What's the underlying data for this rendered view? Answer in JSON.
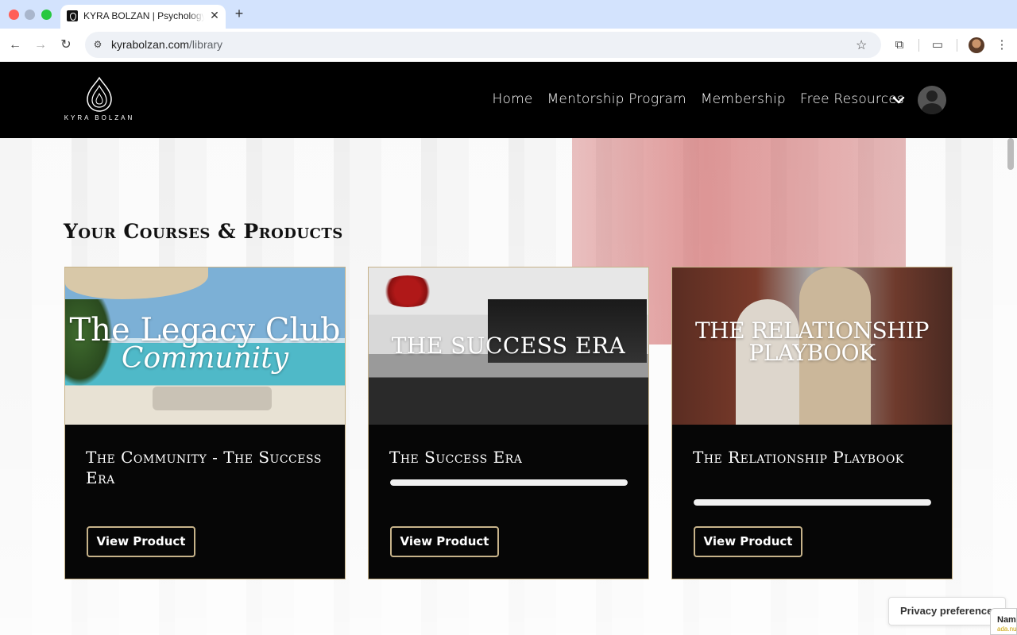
{
  "browser": {
    "tab_title": "KYRA BOLZAN | Psychology & Success",
    "tab_close": "✕",
    "new_tab": "+",
    "url_domain": "kyrabolzan.com",
    "url_path": "/library"
  },
  "header": {
    "logo_text": "KYRA BOLZAN",
    "nav": [
      {
        "label": "Home"
      },
      {
        "label": "Mentorship Program"
      },
      {
        "label": "Membership"
      },
      {
        "label": "Free Resources"
      }
    ]
  },
  "main": {
    "section_title": "Your Courses & Products",
    "cards": [
      {
        "image_title_line1": "The Legacy Club",
        "image_title_line2": "Community",
        "title": "The Community - The Success Era",
        "button": "View Product"
      },
      {
        "image_title": "THE SUCCESS ERA",
        "title": "The Success Era",
        "progress": 1.0,
        "button": "View Product"
      },
      {
        "image_title": "THE RELATIONSHIP PLAYBOOK",
        "title": "The Relationship Playbook",
        "progress": 1.0,
        "button": "View Product"
      }
    ]
  },
  "privacy": {
    "label": "Privacy preferences"
  },
  "widget": {
    "name": "Name",
    "sub": "ada.nu"
  },
  "colors": {
    "header_bg": "#000000",
    "card_bg": "#060606",
    "accent_gold": "#c7b38a"
  },
  "icons": {
    "back": "back-arrow-icon",
    "forward": "forward-arrow-icon",
    "reload": "reload-icon",
    "site_info": "tune-icon",
    "bookmark": "star-icon",
    "extensions": "puzzle-icon",
    "reading_mode": "reading-mode-icon",
    "menu": "kebab-menu-icon",
    "dropdown": "chevron-down-icon"
  }
}
